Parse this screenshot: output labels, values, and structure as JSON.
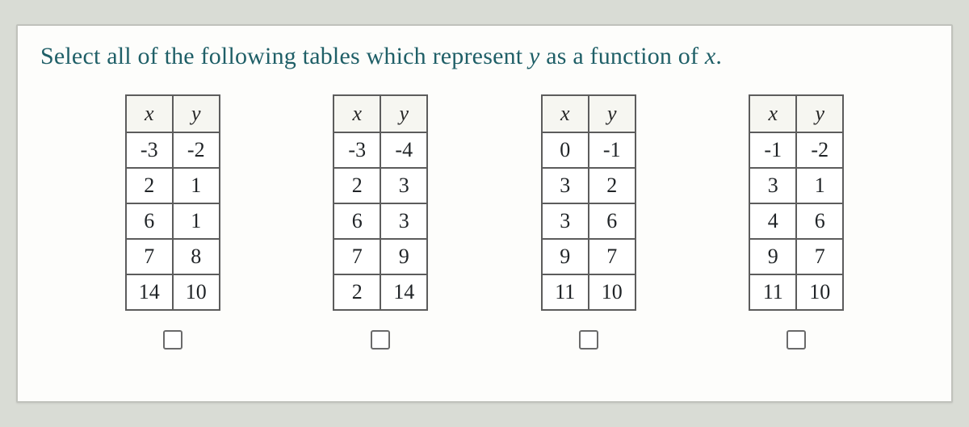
{
  "prompt_parts": {
    "p1": "Select all of the following tables which represent ",
    "var_y": "y",
    "p2": " as a function of ",
    "var_x": "x",
    "p3": "."
  },
  "headers": {
    "x": "x",
    "y": "y"
  },
  "tables": [
    {
      "rows": [
        {
          "x": "-3",
          "y": "-2"
        },
        {
          "x": "2",
          "y": "1"
        },
        {
          "x": "6",
          "y": "1"
        },
        {
          "x": "7",
          "y": "8"
        },
        {
          "x": "14",
          "y": "10"
        }
      ]
    },
    {
      "rows": [
        {
          "x": "-3",
          "y": "-4"
        },
        {
          "x": "2",
          "y": "3"
        },
        {
          "x": "6",
          "y": "3"
        },
        {
          "x": "7",
          "y": "9"
        },
        {
          "x": "2",
          "y": "14"
        }
      ]
    },
    {
      "rows": [
        {
          "x": "0",
          "y": "-1"
        },
        {
          "x": "3",
          "y": "2"
        },
        {
          "x": "3",
          "y": "6"
        },
        {
          "x": "9",
          "y": "7"
        },
        {
          "x": "11",
          "y": "10"
        }
      ]
    },
    {
      "rows": [
        {
          "x": "-1",
          "y": "-2"
        },
        {
          "x": "3",
          "y": "1"
        },
        {
          "x": "4",
          "y": "6"
        },
        {
          "x": "9",
          "y": "7"
        },
        {
          "x": "11",
          "y": "10"
        }
      ]
    }
  ]
}
